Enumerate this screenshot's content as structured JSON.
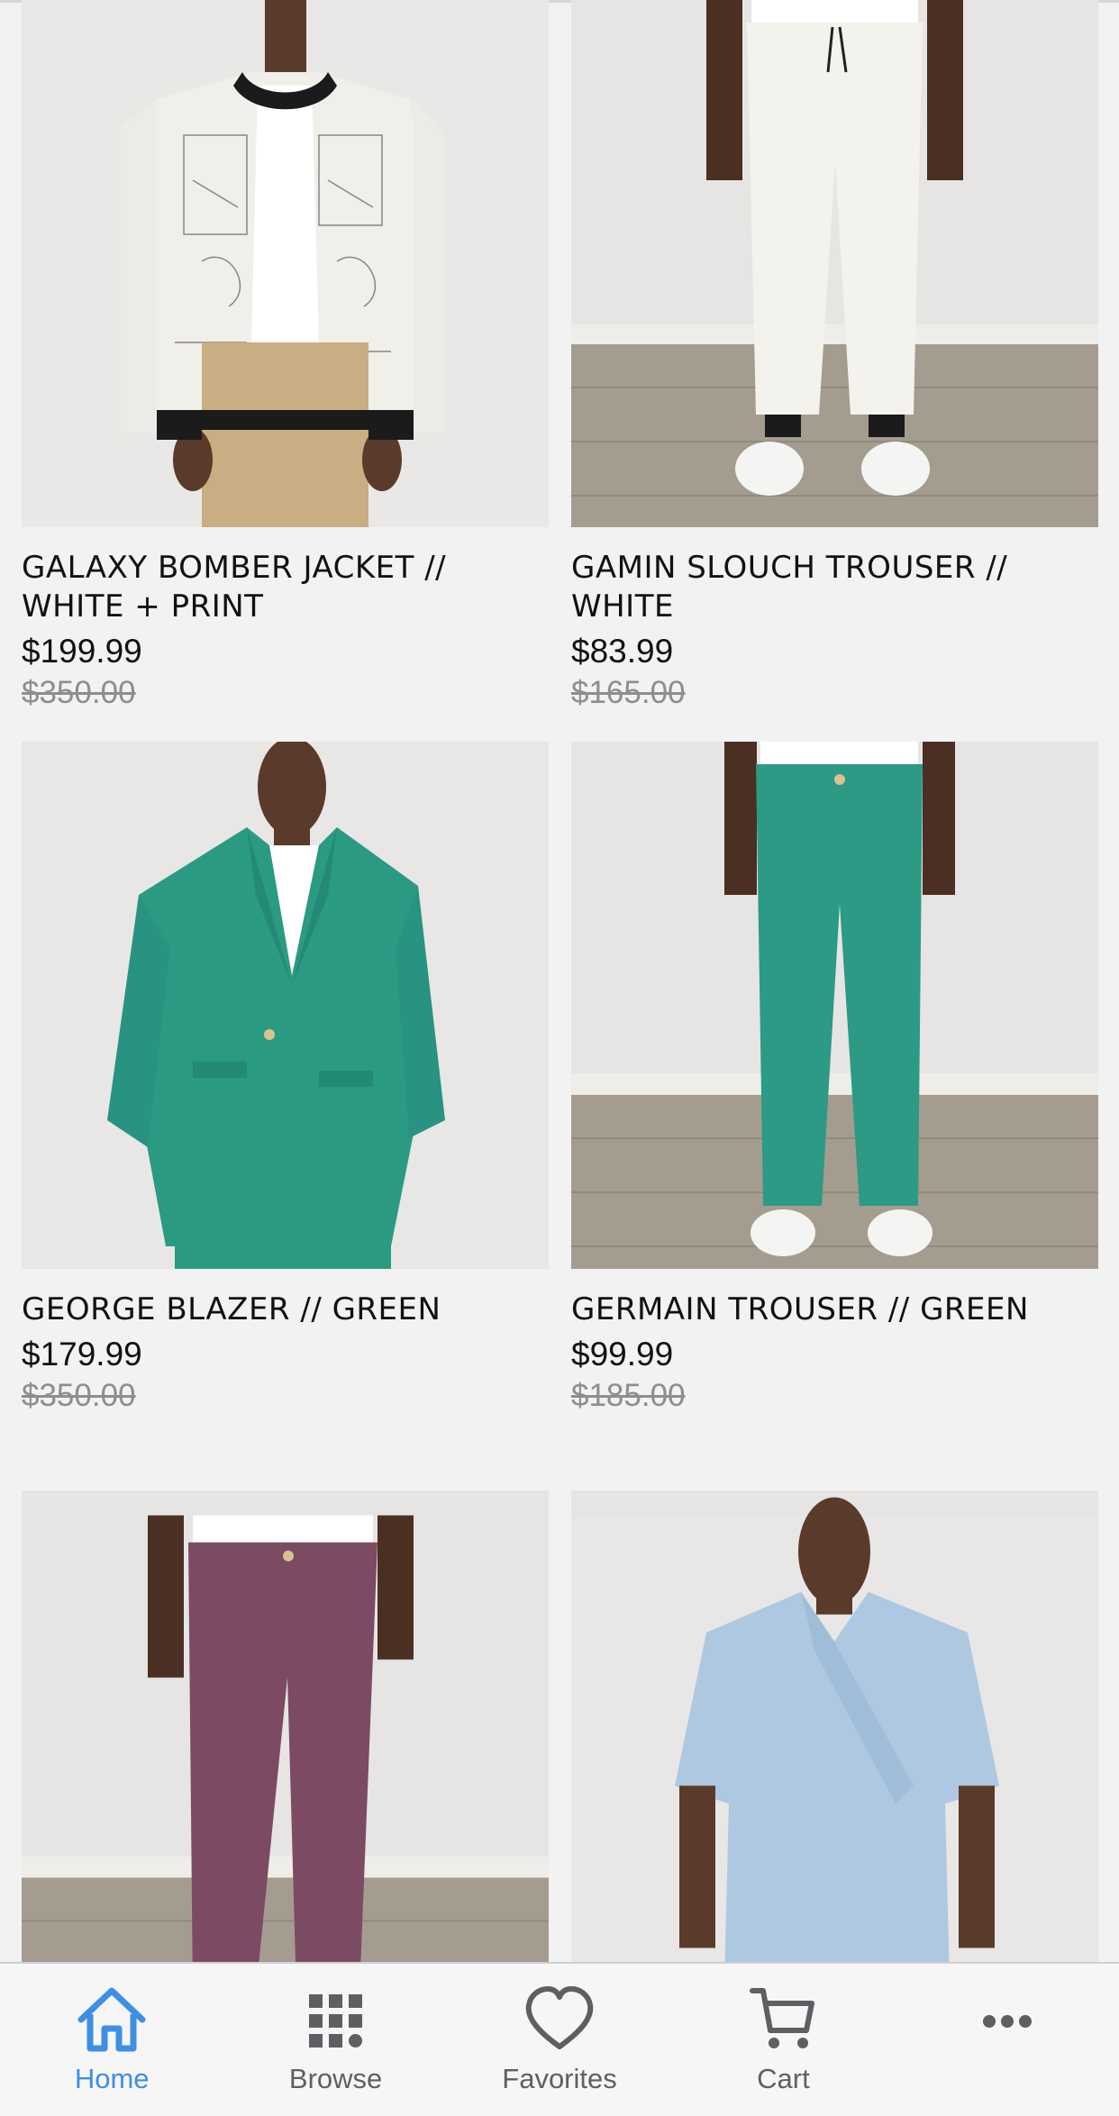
{
  "products": [
    {
      "name": "GALAXY BOMBER JACKET // WHITE + PRINT",
      "price": "$199.99",
      "old_price": "$350.00",
      "image": "white-print-bomber-jacket"
    },
    {
      "name": "GAMIN SLOUCH TROUSER // WHITE",
      "price": "$83.99",
      "old_price": "$165.00",
      "image": "white-trousers"
    },
    {
      "name": "GEORGE BLAZER // GREEN",
      "price": "$179.99",
      "old_price": "$350.00",
      "image": "green-blazer"
    },
    {
      "name": "GERMAIN TROUSER // GREEN",
      "price": "$99.99",
      "old_price": "$185.00",
      "image": "green-trousers"
    },
    {
      "name": "",
      "price": "",
      "old_price": "",
      "image": "purple-corduroy-trousers"
    },
    {
      "name": "",
      "price": "",
      "old_price": "",
      "image": "light-blue-wrap-shirt"
    }
  ],
  "tabbar": {
    "items": [
      {
        "label": "Home",
        "icon": "home-icon",
        "active": true
      },
      {
        "label": "Browse",
        "icon": "grid-icon",
        "active": false
      },
      {
        "label": "Favorites",
        "icon": "heart-icon",
        "active": false
      },
      {
        "label": "Cart",
        "icon": "cart-icon",
        "active": false
      },
      {
        "label": "",
        "icon": "more-icon",
        "active": false
      }
    ]
  },
  "colors": {
    "accent": "#3d8fe6",
    "background": "#f2f2f3",
    "tab_inactive": "#5f5f63",
    "old_price": "#8e8e8e"
  }
}
